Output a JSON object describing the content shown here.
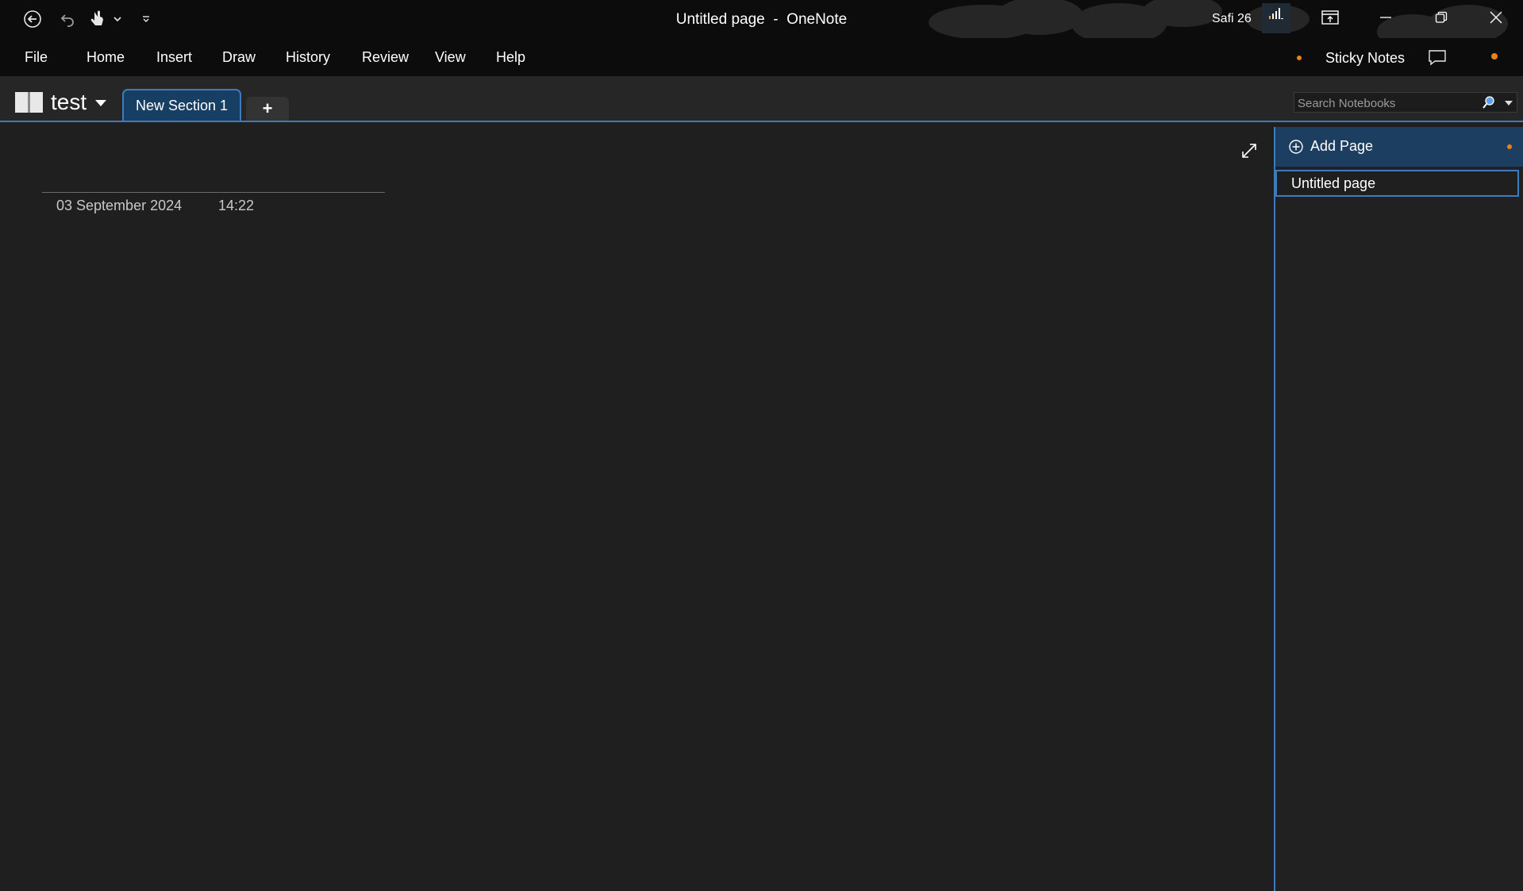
{
  "window": {
    "title": "Untitled page  -  OneNote",
    "user_name": "Safi 26"
  },
  "menu": {
    "items": [
      "File",
      "Home",
      "Insert",
      "Draw",
      "History",
      "Review",
      "View",
      "Help"
    ],
    "sticky_notes": "Sticky Notes"
  },
  "notebook": {
    "name": "test",
    "section_tab": "New Section 1",
    "add_section": "+"
  },
  "search": {
    "placeholder": "Search Notebooks"
  },
  "page": {
    "date": "03 September 2024",
    "time": "14:22"
  },
  "page_panel": {
    "add_page_label": "Add Page",
    "pages": [
      "Untitled page"
    ]
  },
  "colors": {
    "accent_blue": "#3d7bbf",
    "tab_fill": "#173e63",
    "notification_dot": "#e8831c"
  }
}
